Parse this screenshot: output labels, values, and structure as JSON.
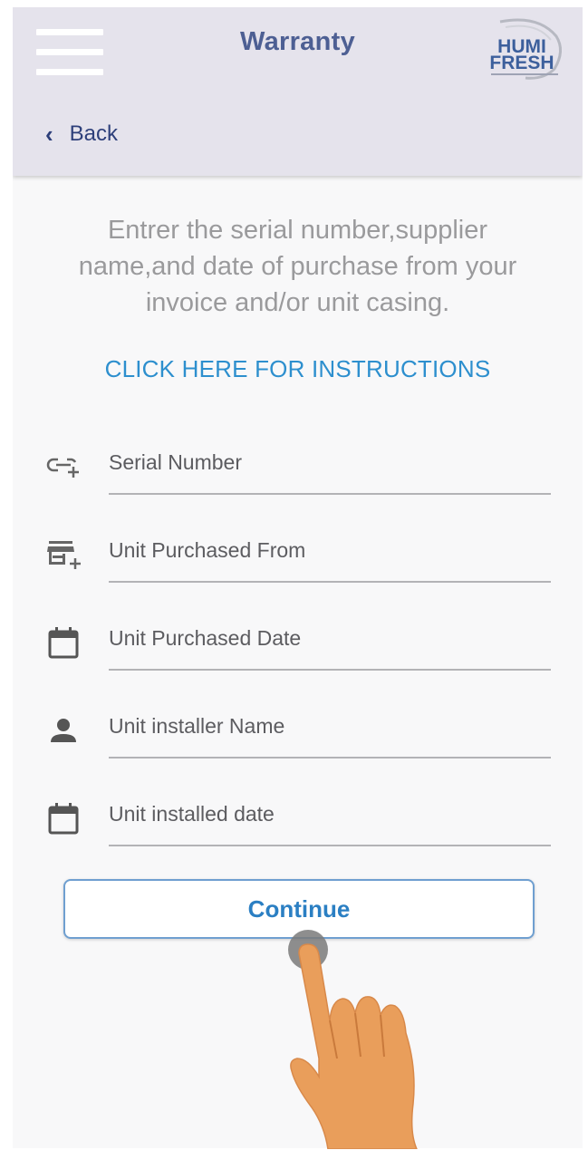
{
  "app_bar": {
    "title": "Warranty",
    "logo_text_top": "HUMI",
    "logo_text_bottom": "FRESH",
    "back_label": "Back"
  },
  "icons": {
    "menu": "hamburger-menu-icon",
    "back": "chevron-left-icon",
    "serial": "link-add-icon",
    "purchased_from": "store-add-icon",
    "purchased_date": "calendar-icon",
    "installer": "person-icon",
    "installed_date": "calendar-icon"
  },
  "intro_text": "Entrer the serial number,supplier name,and date of purchase from your invoice and/or unit casing.",
  "instructions_link": "CLICK HERE FOR INSTRUCTIONS",
  "form": {
    "fields": [
      {
        "placeholder": "Serial Number",
        "value": ""
      },
      {
        "placeholder": "Unit Purchased From",
        "value": ""
      },
      {
        "placeholder": "Unit Purchased Date",
        "value": ""
      },
      {
        "placeholder": "Unit installer Name",
        "value": ""
      },
      {
        "placeholder": "Unit installed date",
        "value": ""
      }
    ],
    "continue_label": "Continue"
  },
  "colors": {
    "app_bar_bg": "#e5e3ec",
    "title": "#4d5f93",
    "link": "#2d8fce",
    "button_border": "#6f9fd0",
    "button_text": "#2b7fc3",
    "page_bg": "#f8f8f9",
    "pointer_hand": "#e99e5b"
  }
}
